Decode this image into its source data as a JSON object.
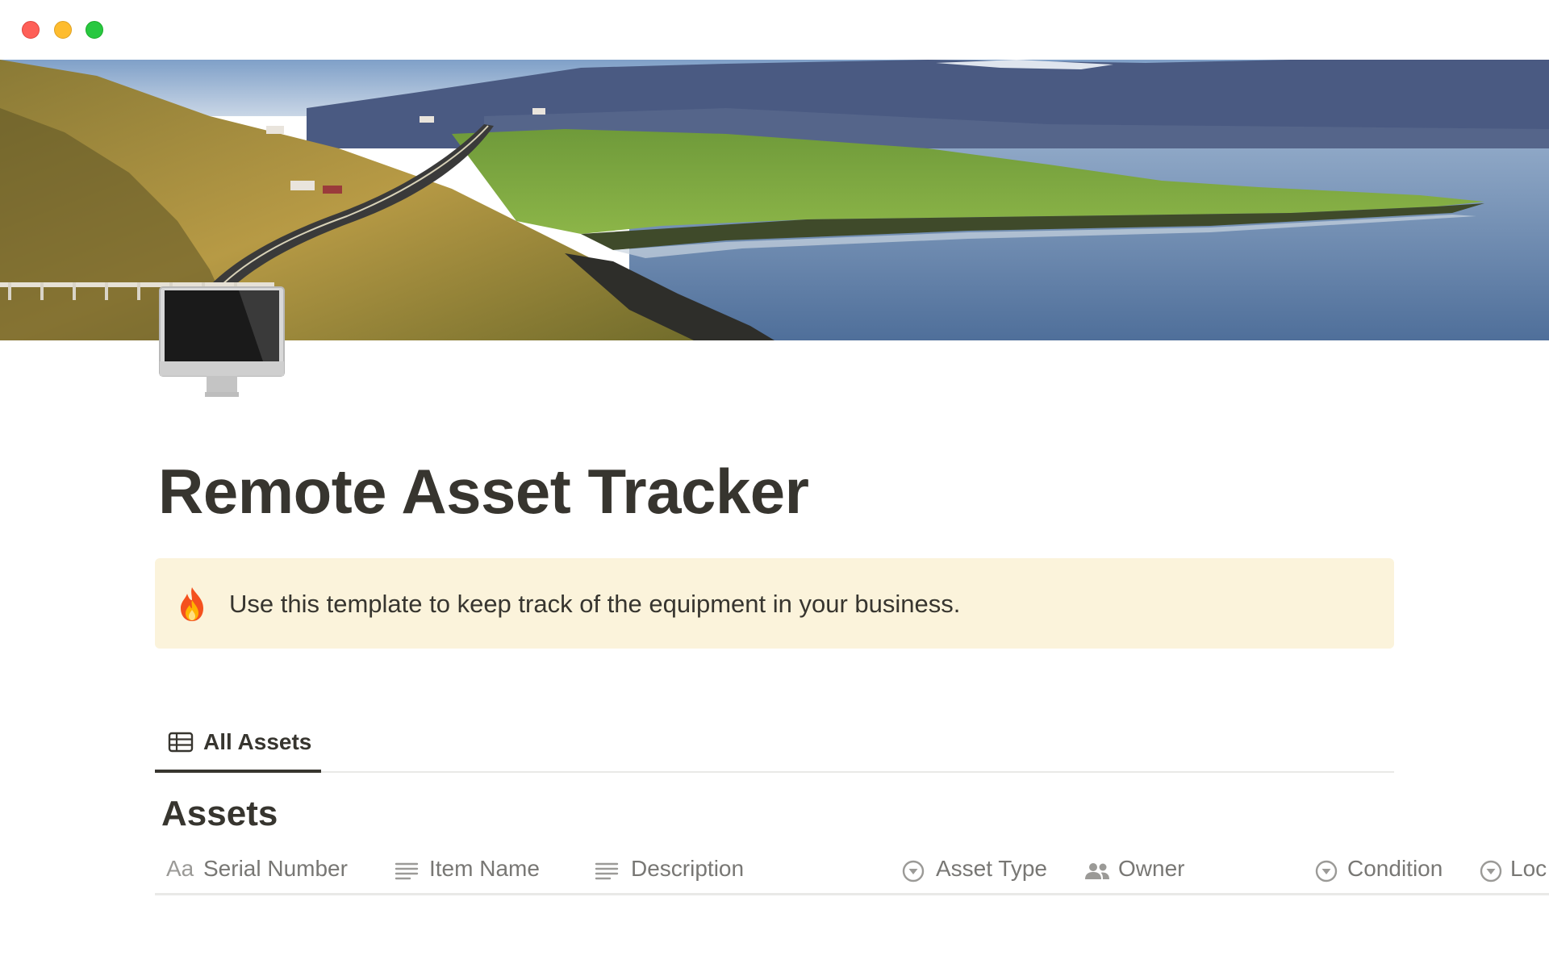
{
  "page": {
    "title": "Remote Asset Tracker",
    "icon": "desktop-computer-icon",
    "cover": "coastal-landscape-cover-image"
  },
  "callout": {
    "icon": "fire-icon",
    "text": "Use this template to keep track of the equipment in your business.",
    "background": "#fbf3db"
  },
  "database": {
    "views": [
      {
        "label": "All Assets",
        "icon": "table-icon",
        "active": true
      }
    ],
    "title": "Assets",
    "columns": [
      {
        "label": "Serial Number",
        "icon": "text-aa-icon",
        "glyph": "Aa"
      },
      {
        "label": "Item Name",
        "icon": "text-lines-icon"
      },
      {
        "label": "Description",
        "icon": "text-lines-icon"
      },
      {
        "label": "Asset Type",
        "icon": "select-circle-icon"
      },
      {
        "label": "Owner",
        "icon": "people-icon"
      },
      {
        "label": "Condition",
        "icon": "select-circle-icon"
      },
      {
        "label": "Loc",
        "icon": "select-circle-icon"
      }
    ]
  },
  "colors": {
    "text": "#37352f",
    "muted": "#787774",
    "divider": "#e9e9e7",
    "traffic_close": "#fe5f57",
    "traffic_min": "#febc2e",
    "traffic_max": "#28c840"
  }
}
